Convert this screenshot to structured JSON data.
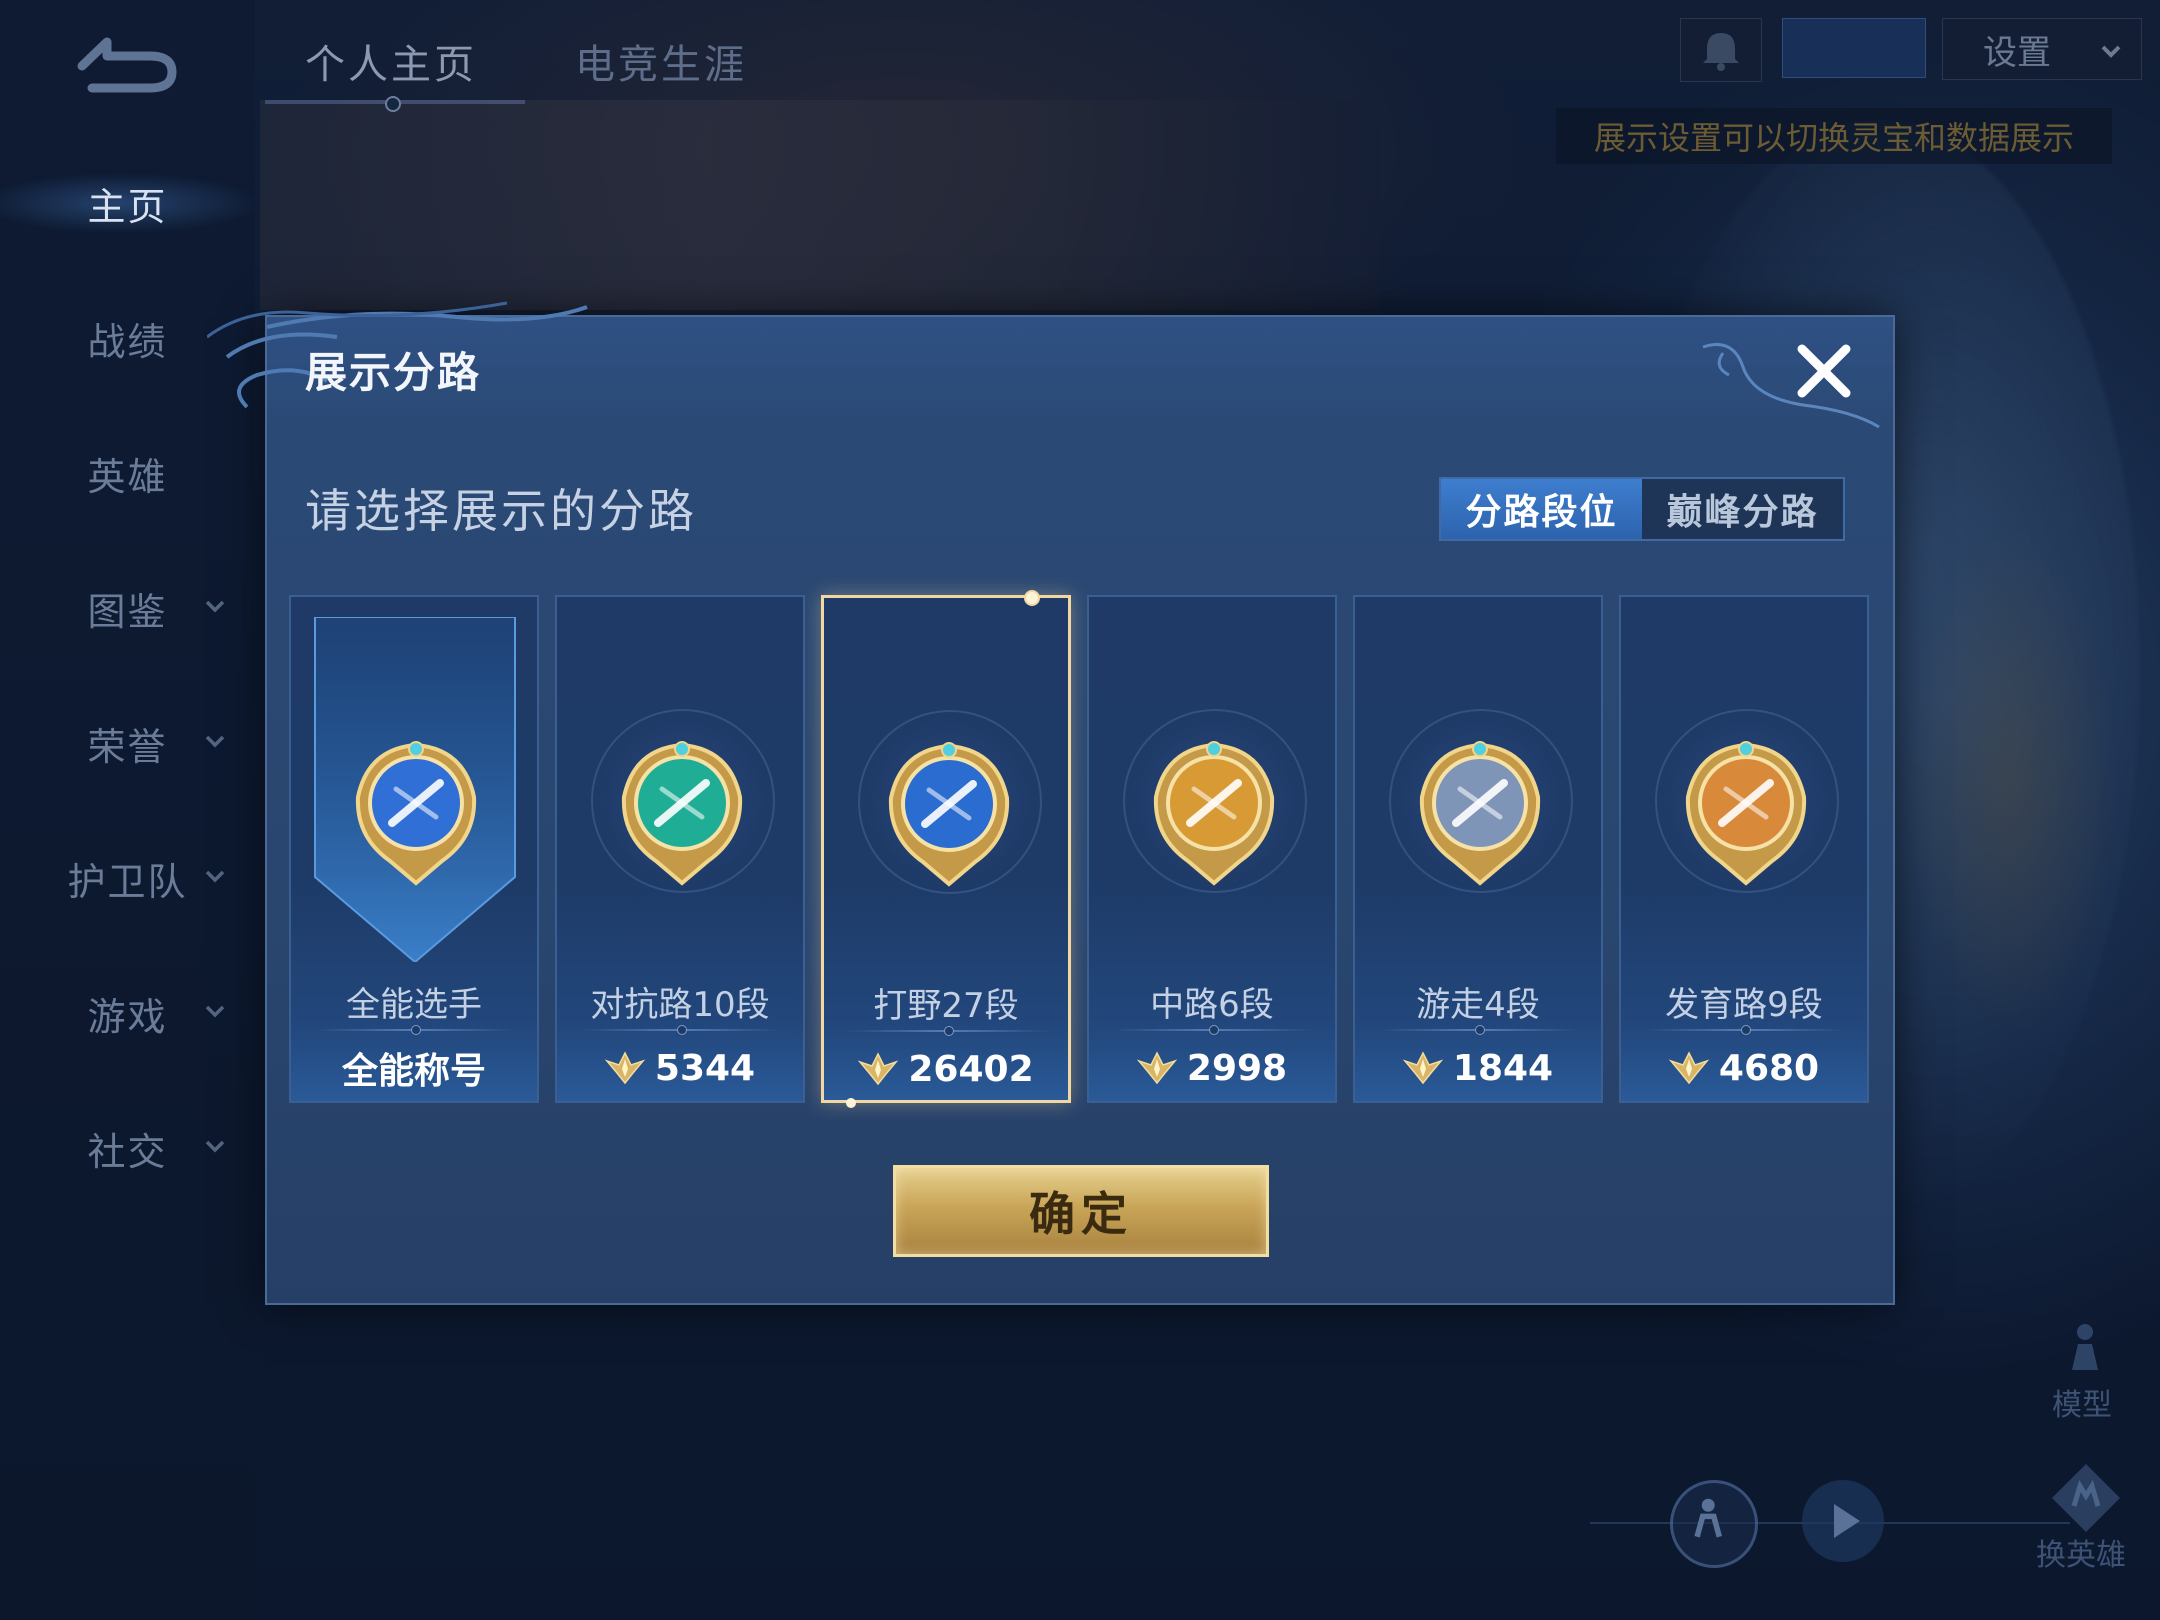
{
  "sidebar": {
    "items": [
      {
        "label": "主页",
        "active": true,
        "has_chevron": false
      },
      {
        "label": "战绩",
        "active": false,
        "has_chevron": false
      },
      {
        "label": "英雄",
        "active": false,
        "has_chevron": false
      },
      {
        "label": "图鉴",
        "active": false,
        "has_chevron": true
      },
      {
        "label": "荣誉",
        "active": false,
        "has_chevron": true
      },
      {
        "label": "护卫队",
        "active": false,
        "has_chevron": true
      },
      {
        "label": "游戏",
        "active": false,
        "has_chevron": true
      },
      {
        "label": "社交",
        "active": false,
        "has_chevron": true
      }
    ]
  },
  "top_tabs": [
    {
      "label": "个人主页",
      "active": true
    },
    {
      "label": "电竞生涯",
      "active": false
    }
  ],
  "top_right": {
    "settings_label": "设置",
    "hint": "展示设置可以切换灵宝和数据展示"
  },
  "bottom_right": {
    "model_label": "模型",
    "switch_hero_label": "换英雄"
  },
  "dialog": {
    "title": "展示分路",
    "subtitle": "请选择展示的分路",
    "segments": [
      {
        "label": "分路段位",
        "active": true
      },
      {
        "label": "巅峰分路",
        "active": false
      }
    ],
    "cards": [
      {
        "name": "全能选手",
        "score": "全能称号",
        "has_points_icon": false,
        "selected": false,
        "emblem": "all-round-emblem-icon",
        "color": "#2f6fd6"
      },
      {
        "name": "对抗路10段",
        "score": "5344",
        "has_points_icon": true,
        "selected": false,
        "emblem": "clash-lane-emblem-icon",
        "color": "#1fae95"
      },
      {
        "name": "打野27段",
        "score": "26402",
        "has_points_icon": true,
        "selected": true,
        "emblem": "jungle-emblem-icon",
        "color": "#2a6cd0"
      },
      {
        "name": "中路6段",
        "score": "2998",
        "has_points_icon": true,
        "selected": false,
        "emblem": "mid-lane-emblem-icon",
        "color": "#d89a34"
      },
      {
        "name": "游走4段",
        "score": "1844",
        "has_points_icon": true,
        "selected": false,
        "emblem": "roam-emblem-icon",
        "color": "#7f95b8"
      },
      {
        "name": "发育路9段",
        "score": "4680",
        "has_points_icon": true,
        "selected": false,
        "emblem": "farm-lane-emblem-icon",
        "color": "#d88a3a"
      }
    ],
    "confirm_label": "确定"
  }
}
